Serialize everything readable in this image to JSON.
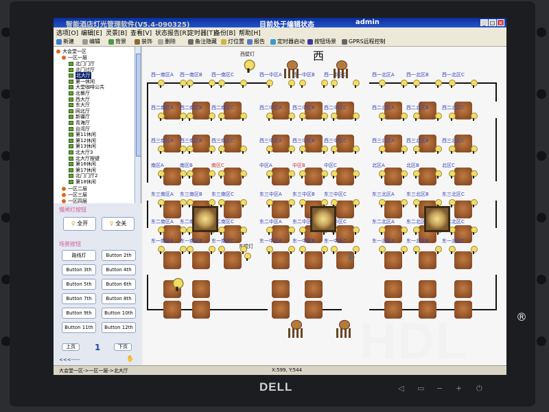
{
  "window": {
    "title": "智能酒店灯光管理软件(V5.4-090325)",
    "status": "目前处于编辑状态",
    "user": "admin"
  },
  "window_buttons": [
    "_",
    "□",
    "×"
  ],
  "menu": [
    "选项[O]",
    "编辑[E]",
    "灵景[B]",
    "查看[V]",
    "状态报告[R]",
    "定时器[T]",
    "备份[B]",
    "帮助[H]"
  ],
  "toolbar": [
    {
      "label": "新建",
      "icon": "new-icon",
      "color": "#3a7bd5"
    },
    {
      "label": "编辑",
      "icon": "edit-icon",
      "color": "#999999"
    },
    {
      "label": "背景",
      "icon": "background-icon",
      "color": "#4a9a4a"
    },
    {
      "label": "装饰",
      "icon": "decor-icon",
      "color": "#8a6a3a"
    },
    {
      "label": "删除",
      "icon": "delete-icon",
      "color": "#aaaaaa"
    },
    {
      "label": "备注隐藏",
      "icon": "note-icon",
      "color": "#6a6a6a"
    },
    {
      "label": "灯位置",
      "icon": "light-position-icon",
      "color": "#d8b040"
    },
    {
      "label": "报告",
      "icon": "report-icon",
      "color": "#5a7ac0"
    },
    {
      "label": "定时器启动",
      "icon": "timer-icon",
      "color": "#3a9ad0"
    },
    {
      "label": "按钮场景",
      "icon": "scene-icon",
      "color": "#3a3a9a"
    },
    {
      "label": "GPRS远程控制",
      "icon": "gprs-icon",
      "color": "#666666"
    }
  ],
  "tree": {
    "root": "大会堂一区",
    "floor": "一区一层",
    "items": [
      "北门门厅",
      "北门过厅",
      "北大厅",
      "第一休闲",
      "大堂咖啡公共",
      "北餐厅",
      "西大厅",
      "东大厅",
      "网北厅",
      "新疆厅",
      "青海厅",
      "台湾厅",
      "第11休闲",
      "第12休闲",
      "第13休闲",
      "北大厅3",
      "北大厅按键",
      "第16休闲",
      "第17休闲",
      "北门门厅2",
      "第18休闲"
    ],
    "selected": "北大厅",
    "floors_after": [
      "一区二层",
      "一区三层",
      "一区四层"
    ]
  },
  "light_panel": {
    "title": "慢闸灯按钮",
    "all_on": "全开",
    "all_off": "全关"
  },
  "scene_panel": {
    "title": "场景按钮",
    "buttons": [
      "路线灯",
      "Button 2th",
      "Button 3th",
      "Button 4th",
      "Button 5th",
      "Button 6th",
      "Button 7th",
      "Button 8th",
      "Button 9th",
      "Button 10th",
      "Button 11th",
      "Button 12th"
    ],
    "prev": "上页",
    "next": "下页",
    "page": "1"
  },
  "statusbar": {
    "path": "大会堂一区->一区一层->北大厅",
    "coords": "X:599, Y:544",
    "scroll_hint": "<<<-----"
  },
  "plan": {
    "west_char": "西",
    "top_light": "西壁灯",
    "east_light": "东壁灯",
    "row1_labels": [
      "西一南区A",
      "西一南区B",
      "西一南区C",
      "西一中区A",
      "西一中区B",
      "西一中区C",
      "西一北区A",
      "西一北区B",
      "西一北区C"
    ],
    "row2_labels": [
      "西二南区A",
      "西二南区B",
      "西二南区C",
      "西二中区A",
      "西二中区B",
      "西二中区C",
      "西二北区A",
      "西二北区B",
      "西二北区C"
    ],
    "row3_labels": [
      "西三南区A",
      "西三南区B",
      "西三南区C",
      "西三中区A",
      "西三中区B",
      "西三中区C",
      "西三北区A",
      "西三北区B",
      "西三北区C"
    ],
    "row4_labels": [
      "南区A",
      "南区B",
      "南区C",
      "中区A",
      "中区B",
      "中区C",
      "北区A",
      "北区B",
      "北区C"
    ],
    "row5_labels": [
      "东三南区A",
      "东三南区B",
      "东三南区C",
      "东三中区A",
      "东三中区B",
      "东三中区C",
      "东三北区A",
      "东三北区B",
      "东三北区C"
    ],
    "row6_labels": [
      "东二南区A",
      "东二南区B",
      "东二南区C",
      "东二中区A",
      "东二中区B",
      "东二中区C",
      "东二北区A",
      "东二北区B",
      "东二北区C"
    ],
    "row7_labels": [
      "东一南区A",
      "东一南区B",
      "东一南区C",
      "东一中区A",
      "东一中区B",
      "东一中区C",
      "东一北区A",
      "东一北区B",
      "东一北区C"
    ]
  },
  "monitor": {
    "brand": "DELL",
    "controls": [
      "◁",
      "▭",
      "−",
      "+",
      "⏻"
    ]
  },
  "watermark": {
    "text": "HDL",
    "reg": "®"
  },
  "colors": {
    "titlebar": "#0a2f9e",
    "label_blue": "#2f3fb4",
    "label_red": "#c43030",
    "panel_title": "#cf5c98",
    "table": "#9b5a2c"
  }
}
